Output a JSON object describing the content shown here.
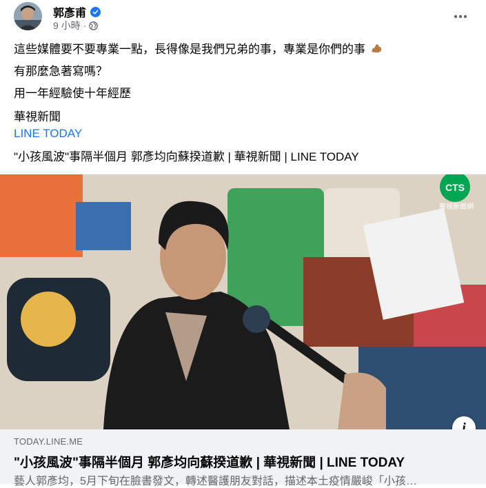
{
  "post": {
    "author": "郭彥甫",
    "timestamp": "9 小時",
    "meta_separator": "·",
    "lines": [
      "這些媒體要不要專業一點，長得像是我們兄弟的事，專業是你們的事",
      "有那麼急著寫嗎？",
      "用一年經驗使十年經歷",
      "華視新聞",
      "LINE TODAY",
      "\"小孩風波\"事隔半個月 郭彥均向蘇揆道歉 | 華視新聞 | LINE TODAY"
    ]
  },
  "media": {
    "watermark_logo": "CTS",
    "watermark_caption": "華視新聞網",
    "info_glyph": "i"
  },
  "link_card": {
    "domain": "TODAY.LINE.ME",
    "title": "\"小孩風波\"事隔半個月 郭彥均向蘇揆道歉 | 華視新聞 | LINE TODAY",
    "description": "藝人郭彥均，5月下旬在臉書發文，轉述醫護朋友對話，描述本土疫情嚴峻「小孩…"
  },
  "icons": {
    "verified": "verified-badge-icon",
    "privacy": "globe-icon",
    "more": "more-dots-icon",
    "emoji": "flexed-biceps-icon",
    "info": "info-icon"
  },
  "colors": {
    "link": "#1877f2",
    "secondary_text": "#65676b",
    "card_background": "#f0f2f5",
    "cts_logo": "#00a651"
  }
}
